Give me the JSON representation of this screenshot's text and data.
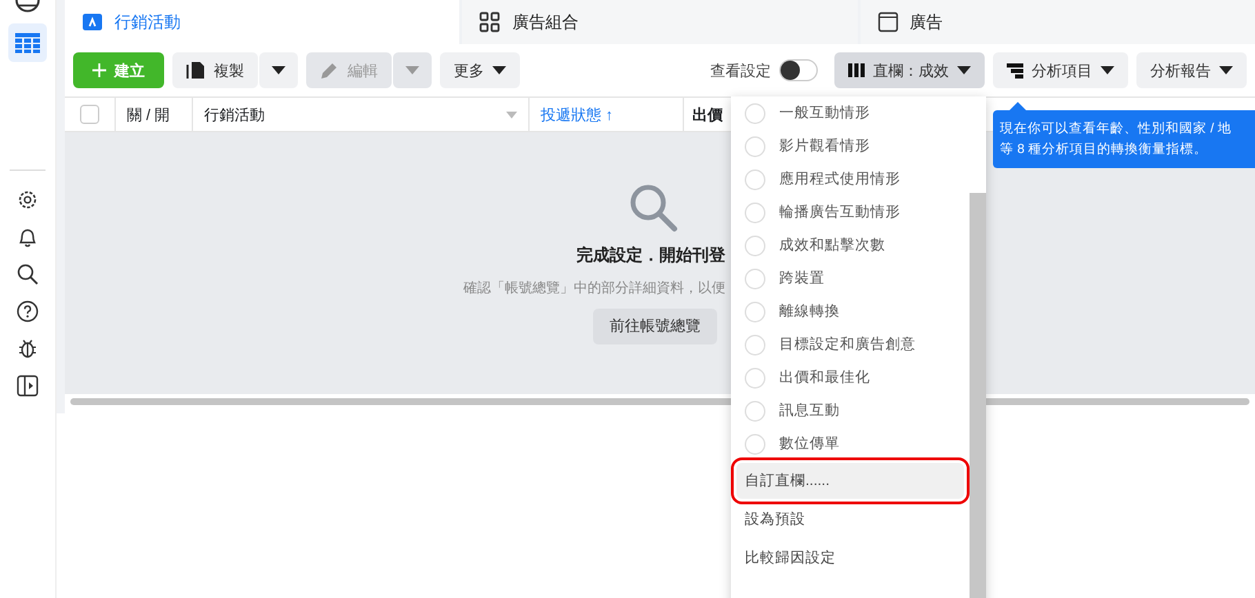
{
  "tabs": [
    {
      "label": "行銷活動",
      "selected": true
    },
    {
      "label": "廣告組合",
      "selected": false
    },
    {
      "label": "廣告",
      "selected": false
    }
  ],
  "toolbar": {
    "create": "建立",
    "duplicate": "複製",
    "edit": {
      "label": "編輯",
      "disabled": true
    },
    "more": "更多",
    "view_settings": {
      "label": "查看設定",
      "on": false
    },
    "columns": "直欄：成效",
    "breakdown": "分析項目",
    "reports": "分析報告"
  },
  "table": {
    "select_all": {
      "checked": false
    },
    "columns": [
      {
        "label": "關 / 開",
        "kind": "plain"
      },
      {
        "label": "行銷活動",
        "kind": "sortable"
      },
      {
        "label": "投遞狀態 ↑",
        "kind": "sorted"
      },
      {
        "label": "出價",
        "kind": "plain"
      }
    ]
  },
  "empty_state": {
    "title": "完成設定．開始刊登",
    "message": "確認「帳號總覽」中的部分詳細資料，以便",
    "button": "前往帳號總覽"
  },
  "column_menu": [
    {
      "label": "一般互動情形",
      "kind": "radio",
      "selected": false
    },
    {
      "label": "影片觀看情形",
      "kind": "radio",
      "selected": false
    },
    {
      "label": "應用程式使用情形",
      "kind": "radio",
      "selected": false
    },
    {
      "label": "輪播廣告互動情形",
      "kind": "radio",
      "selected": false
    },
    {
      "label": "成效和點擊次數",
      "kind": "radio",
      "selected": false
    },
    {
      "label": "跨裝置",
      "kind": "radio",
      "selected": false
    },
    {
      "label": "離線轉換",
      "kind": "radio",
      "selected": false
    },
    {
      "label": "目標設定和廣告創意",
      "kind": "radio",
      "selected": false
    },
    {
      "label": "出價和最佳化",
      "kind": "radio",
      "selected": false
    },
    {
      "label": "訊息互動",
      "kind": "radio",
      "selected": false
    },
    {
      "label": "數位傳單",
      "kind": "radio",
      "selected": false
    },
    {
      "label": "自訂直欄......",
      "kind": "action",
      "highlighted": true
    },
    {
      "label": "設為預設",
      "kind": "action",
      "highlighted": false
    },
    {
      "label": "比較歸因設定",
      "kind": "action",
      "highlighted": false
    }
  ],
  "tooltip": {
    "lines": [
      "現在你可以查看年齡、性別和國家 / 地",
      "等 8 種分析項目的轉換衡量指標。"
    ]
  }
}
